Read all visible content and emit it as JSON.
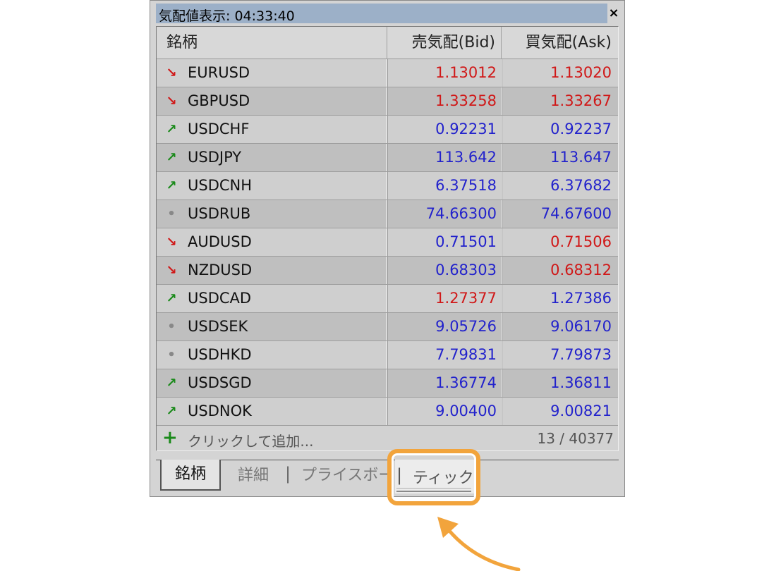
{
  "window": {
    "title": "気配値表示: 04:33:40",
    "close_label": "×"
  },
  "columns": {
    "symbol": "銘柄",
    "bid": "売気配(Bid)",
    "ask": "買気配(Ask)"
  },
  "rows": [
    {
      "symbol": "EURUSD",
      "bid": "1.13012",
      "ask": "1.13020",
      "trend": "down",
      "bid_color": "red",
      "ask_color": "red"
    },
    {
      "symbol": "GBPUSD",
      "bid": "1.33258",
      "ask": "1.33267",
      "trend": "down",
      "bid_color": "red",
      "ask_color": "red"
    },
    {
      "symbol": "USDCHF",
      "bid": "0.92231",
      "ask": "0.92237",
      "trend": "up",
      "bid_color": "blue",
      "ask_color": "blue"
    },
    {
      "symbol": "USDJPY",
      "bid": "113.642",
      "ask": "113.647",
      "trend": "up",
      "bid_color": "blue",
      "ask_color": "blue"
    },
    {
      "symbol": "USDCNH",
      "bid": "6.37518",
      "ask": "6.37682",
      "trend": "up",
      "bid_color": "blue",
      "ask_color": "blue"
    },
    {
      "symbol": "USDRUB",
      "bid": "74.66300",
      "ask": "74.67600",
      "trend": "flat",
      "bid_color": "blue",
      "ask_color": "blue"
    },
    {
      "symbol": "AUDUSD",
      "bid": "0.71501",
      "ask": "0.71506",
      "trend": "down",
      "bid_color": "blue",
      "ask_color": "red"
    },
    {
      "symbol": "NZDUSD",
      "bid": "0.68303",
      "ask": "0.68312",
      "trend": "down",
      "bid_color": "blue",
      "ask_color": "red"
    },
    {
      "symbol": "USDCAD",
      "bid": "1.27377",
      "ask": "1.27386",
      "trend": "up",
      "bid_color": "red",
      "ask_color": "blue"
    },
    {
      "symbol": "USDSEK",
      "bid": "9.05726",
      "ask": "9.06170",
      "trend": "flat",
      "bid_color": "blue",
      "ask_color": "blue"
    },
    {
      "symbol": "USDHKD",
      "bid": "7.79831",
      "ask": "7.79873",
      "trend": "flat",
      "bid_color": "blue",
      "ask_color": "blue"
    },
    {
      "symbol": "USDSGD",
      "bid": "1.36774",
      "ask": "1.36811",
      "trend": "up",
      "bid_color": "blue",
      "ask_color": "blue"
    },
    {
      "symbol": "USDNOK",
      "bid": "9.00400",
      "ask": "9.00821",
      "trend": "up",
      "bid_color": "blue",
      "ask_color": "blue"
    }
  ],
  "add_row": {
    "plus": "+",
    "label": "クリックして追加...",
    "count": "13 / 40377"
  },
  "tabs": {
    "symbols": "銘柄",
    "details": "詳細",
    "price_board": "プライスボード",
    "tick": "ティック",
    "separator": "|"
  },
  "icons": {
    "up": "↗",
    "down": "↘",
    "flat": "•"
  },
  "colors": {
    "up": "#1a8a1a",
    "down": "#d01818",
    "value_red": "#d01818",
    "value_blue": "#2222cc",
    "highlight": "#f2a43c"
  }
}
